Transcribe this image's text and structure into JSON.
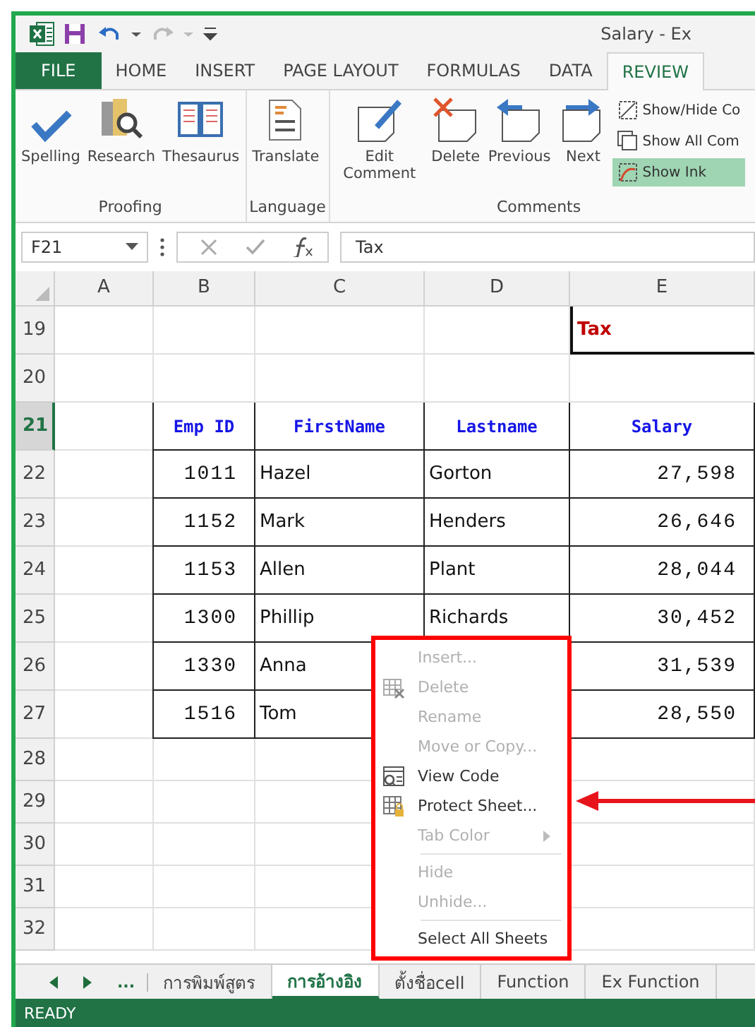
{
  "window": {
    "title": "Salary - Ex"
  },
  "quick_access": [
    {
      "kind": "save"
    },
    {
      "kind": "undo"
    },
    {
      "kind": "redo",
      "disabled": true
    },
    {
      "kind": "customize"
    }
  ],
  "ribbon_tabs": [
    {
      "label": "FILE",
      "kind": "file",
      "selected": false
    },
    {
      "label": "HOME",
      "kind": "tab",
      "selected": false
    },
    {
      "label": "INSERT",
      "kind": "tab",
      "selected": false
    },
    {
      "label": "PAGE LAYOUT",
      "kind": "tab",
      "selected": false
    },
    {
      "label": "FORMULAS",
      "kind": "tab",
      "selected": false
    },
    {
      "label": "DATA",
      "kind": "tab",
      "selected": false
    },
    {
      "label": "REVIEW",
      "kind": "tab",
      "selected": true
    }
  ],
  "ribbon_groups": [
    {
      "name": "Proofing",
      "buttons": [
        {
          "label": "Spelling"
        },
        {
          "label": "Research"
        },
        {
          "label": "Thesaurus"
        }
      ]
    },
    {
      "name": "Language",
      "buttons": [
        {
          "label": "Translate"
        }
      ]
    },
    {
      "name": "Comments",
      "buttons": [
        {
          "label": "Edit Comment"
        },
        {
          "label": "Delete"
        },
        {
          "label": "Previous"
        },
        {
          "label": "Next"
        }
      ],
      "small_buttons": [
        {
          "label": "Show/Hide Co",
          "selected": false
        },
        {
          "label": "Show All Com",
          "selected": false
        },
        {
          "label": "Show Ink",
          "selected": true
        }
      ]
    }
  ],
  "name_box": "F21",
  "formula": "Tax",
  "columns": [
    "A",
    "B",
    "C",
    "D",
    "E"
  ],
  "rows": [
    {
      "number": "19",
      "selected": false,
      "kind": "label",
      "E": "Tax"
    },
    {
      "number": "20",
      "selected": false,
      "kind": "blank"
    },
    {
      "number": "21",
      "selected": true,
      "kind": "header",
      "B": "Emp ID",
      "C": "FirstName",
      "D": "Lastname",
      "E": "Salary"
    },
    {
      "number": "22",
      "selected": false,
      "kind": "data",
      "B": "1011",
      "C": "Hazel",
      "D": "Gorton",
      "E": "27,598"
    },
    {
      "number": "23",
      "selected": false,
      "kind": "data",
      "B": "1152",
      "C": "Mark",
      "D": "Henders",
      "E": "26,646"
    },
    {
      "number": "24",
      "selected": false,
      "kind": "data",
      "B": "1153",
      "C": "Allen",
      "D": "Plant",
      "E": "28,044"
    },
    {
      "number": "25",
      "selected": false,
      "kind": "data",
      "B": "1300",
      "C": "Phillip",
      "D": "Richards",
      "E": "30,452"
    },
    {
      "number": "26",
      "selected": false,
      "kind": "data",
      "B": "1330",
      "C": "Anna",
      "E": "31,539"
    },
    {
      "number": "27",
      "selected": false,
      "kind": "data",
      "B": "1516",
      "C": "Tom",
      "E": "28,550"
    },
    {
      "number": "28",
      "selected": false,
      "kind": "blank"
    },
    {
      "number": "29",
      "selected": false,
      "kind": "blank"
    },
    {
      "number": "30",
      "selected": false,
      "kind": "blank"
    },
    {
      "number": "31",
      "selected": false,
      "kind": "blank"
    },
    {
      "number": "32",
      "selected": false,
      "kind": "blank"
    }
  ],
  "context_menu": [
    {
      "label": "Insert...",
      "disabled": true
    },
    {
      "label": "Delete",
      "disabled": true
    },
    {
      "label": "Rename",
      "disabled": true
    },
    {
      "label": "Move or Copy...",
      "disabled": true
    },
    {
      "label": "View Code",
      "disabled": false
    },
    {
      "label": "Protect Sheet...",
      "disabled": false
    },
    {
      "label": "Tab Color",
      "disabled": true,
      "submenu": true,
      "separator_after": true
    },
    {
      "label": "Hide",
      "disabled": true
    },
    {
      "label": "Unhide...",
      "disabled": true,
      "separator_after": true
    },
    {
      "label": "Select All Sheets",
      "disabled": false
    }
  ],
  "sheet_nav": {
    "more": "..."
  },
  "sheet_tabs": [
    {
      "label": "การพิมพ์สูตร",
      "selected": false
    },
    {
      "label": "การอ้างอิง",
      "selected": true
    },
    {
      "label": "ตั้งชื่อcell",
      "selected": false
    },
    {
      "label": "Function",
      "selected": false
    },
    {
      "label": "Ex Function",
      "selected": false
    }
  ],
  "status_bar": {
    "text": "READY"
  }
}
